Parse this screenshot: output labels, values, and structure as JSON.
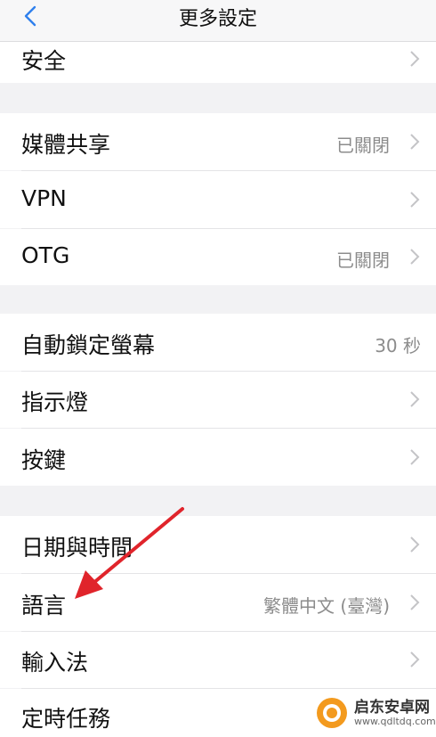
{
  "nav": {
    "title": "更多設定"
  },
  "rows": [
    {
      "label": "安全",
      "value": ""
    },
    {
      "label": "媒體共享",
      "value": "已關閉"
    },
    {
      "label": "VPN",
      "value": ""
    },
    {
      "label": "OTG",
      "value": "已關閉"
    },
    {
      "label": "自動鎖定螢幕",
      "value": "30 秒"
    },
    {
      "label": "指示燈",
      "value": ""
    },
    {
      "label": "按鍵",
      "value": ""
    },
    {
      "label": "日期與時間",
      "value": ""
    },
    {
      "label": "語言",
      "value": "繁體中文 (臺灣)"
    },
    {
      "label": "輸入法",
      "value": ""
    },
    {
      "label": "定時任務",
      "value": ""
    }
  ],
  "watermark": {
    "name": "启东安卓网",
    "url": "www.qdltdq.com"
  },
  "colors": {
    "accent": "#2f80ed",
    "annotation_arrow": "#e0242b"
  }
}
